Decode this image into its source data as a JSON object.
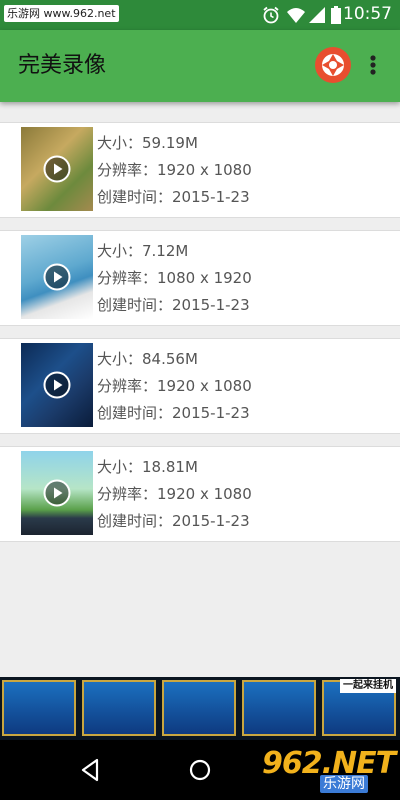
{
  "status_bar": {
    "watermark": "乐游网 www.962.net",
    "time": "10:57"
  },
  "app_bar": {
    "title": "完美录像"
  },
  "videos": [
    {
      "size": "大小：59.19M",
      "resolution": "分辨率：1920 x 1080",
      "created": "创建时间：2015-1-23"
    },
    {
      "size": "大小：7.12M",
      "resolution": "分辨率：1080 x 1920",
      "created": "创建时间：2015-1-23"
    },
    {
      "size": "大小：84.56M",
      "resolution": "分辨率：1920 x 1080",
      "created": "创建时间：2015-1-23"
    },
    {
      "size": "大小：18.81M",
      "resolution": "分辨率：1920 x 1080",
      "created": "创建时间：2015-1-23"
    }
  ],
  "ad_banner": {
    "text": "一起来挂机"
  },
  "site_logo": {
    "number": "962.NET",
    "name": "乐游网"
  },
  "colors": {
    "status_bar": "#2e8a3a",
    "app_bar": "#4caf50",
    "record_button": "#e84e2f"
  },
  "icons": [
    "alarm-icon",
    "wifi-icon",
    "signal-icon",
    "battery-icon",
    "camera-shutter-icon",
    "more-vert-icon",
    "play-icon",
    "back-icon",
    "home-icon"
  ]
}
